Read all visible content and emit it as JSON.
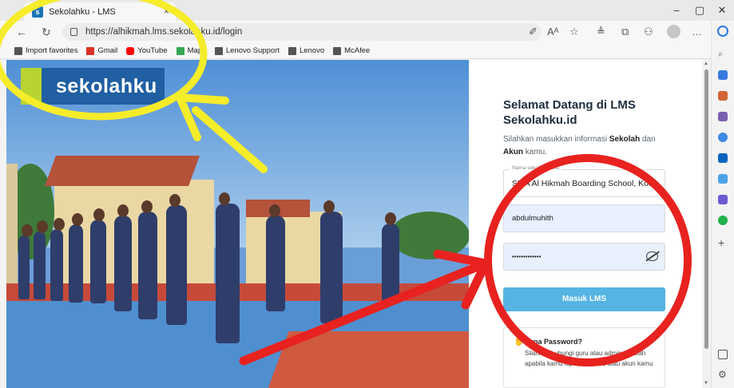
{
  "browser": {
    "tab_title": "Sekolahku - LMS",
    "tab_close": "×",
    "url": "https://alhikmah.lms.sekolahku.id/login",
    "window": {
      "minimize": "–",
      "restore": "▢",
      "close": "✕"
    },
    "nav": {
      "back": "←",
      "reload": "↻"
    },
    "tools": [
      "✐",
      "Aᴬ",
      "☆",
      "≜",
      "⧉",
      "⚇",
      "…"
    ]
  },
  "favorites": [
    {
      "label": "Import favorites",
      "icon": "folder-icon",
      "color": "#555555"
    },
    {
      "label": "Gmail",
      "icon": "gmail-icon",
      "color": "#d93025"
    },
    {
      "label": "YouTube",
      "icon": "youtube-icon",
      "color": "#ff0000"
    },
    {
      "label": "Maps",
      "icon": "maps-icon",
      "color": "#34a853"
    },
    {
      "label": "Lenovo Support",
      "icon": "page-icon",
      "color": "#555555"
    },
    {
      "label": "Lenovo",
      "icon": "page-icon",
      "color": "#555555"
    },
    {
      "label": "McAfee",
      "icon": "page-icon",
      "color": "#555555"
    }
  ],
  "hero": {
    "logo_text": "sekolahku"
  },
  "login": {
    "title": "Selamat Datang di LMS Sekolahku.id",
    "subtitle_pre": "Silahkan masukkan informasi ",
    "subtitle_b1": "Sekolah",
    "subtitle_mid": " dan ",
    "subtitle_b2": "Akun",
    "subtitle_post": " kamu.",
    "school_legend": "Nama sekolah kamu",
    "school_value": "SMA Al Hikmah Boarding School, Kot...",
    "username_value": "abdulmuhith",
    "password_value": "•••••••••••••",
    "button_label": "Masuk LMS",
    "forgot_title": "Lupa Password?",
    "forgot_text": "Silahkan hubungi guru atau admin sekolah apabila kamu lupa password atau akun kamu"
  },
  "colors": {
    "brand_blue": "#1f5fa2",
    "brand_green": "#b8d430",
    "button": "#55b4e3",
    "annotation_red": "#e8221f",
    "annotation_yellow": "#f5ec2a"
  }
}
